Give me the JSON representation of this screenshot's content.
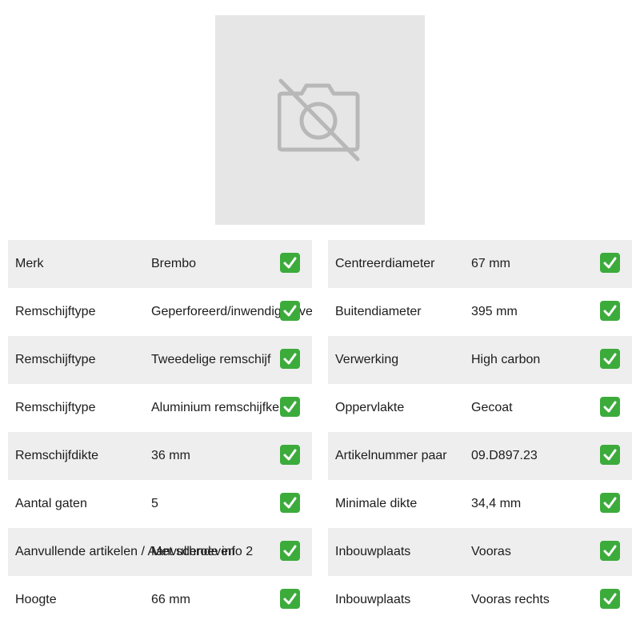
{
  "image": {
    "placeholder_icon": "no-photo-camera-icon",
    "placeholder_color": "#b8b8b8",
    "background": "#e6e6e6"
  },
  "check_color": "#3cab3b",
  "left_table": [
    {
      "label": "Merk",
      "value": "Brembo"
    },
    {
      "label": "Remschijftype",
      "value": "Geperforeerd/inwendig geventileerd"
    },
    {
      "label": "Remschijftype",
      "value": "Tweedelige remschijf"
    },
    {
      "label": "Remschijftype",
      "value": "Aluminium remschijfkern"
    },
    {
      "label": "Remschijfdikte",
      "value": "36 mm"
    },
    {
      "label": "Aantal gaten",
      "value": "5"
    },
    {
      "label": "Aanvullende artikelen / Aanvullende info 2",
      "value": "Met schroeven"
    },
    {
      "label": "Hoogte",
      "value": "66 mm"
    }
  ],
  "right_table": [
    {
      "label": "Centreerdiameter",
      "value": "67 mm"
    },
    {
      "label": "Buitendiameter",
      "value": "395 mm"
    },
    {
      "label": "Verwerking",
      "value": "High carbon"
    },
    {
      "label": "Oppervlakte",
      "value": "Gecoat"
    },
    {
      "label": "Artikelnummer paar",
      "value": "09.D897.23"
    },
    {
      "label": "Minimale dikte",
      "value": "34,4 mm"
    },
    {
      "label": "Inbouwplaats",
      "value": "Vooras"
    },
    {
      "label": "Inbouwplaats",
      "value": "Vooras rechts"
    }
  ]
}
